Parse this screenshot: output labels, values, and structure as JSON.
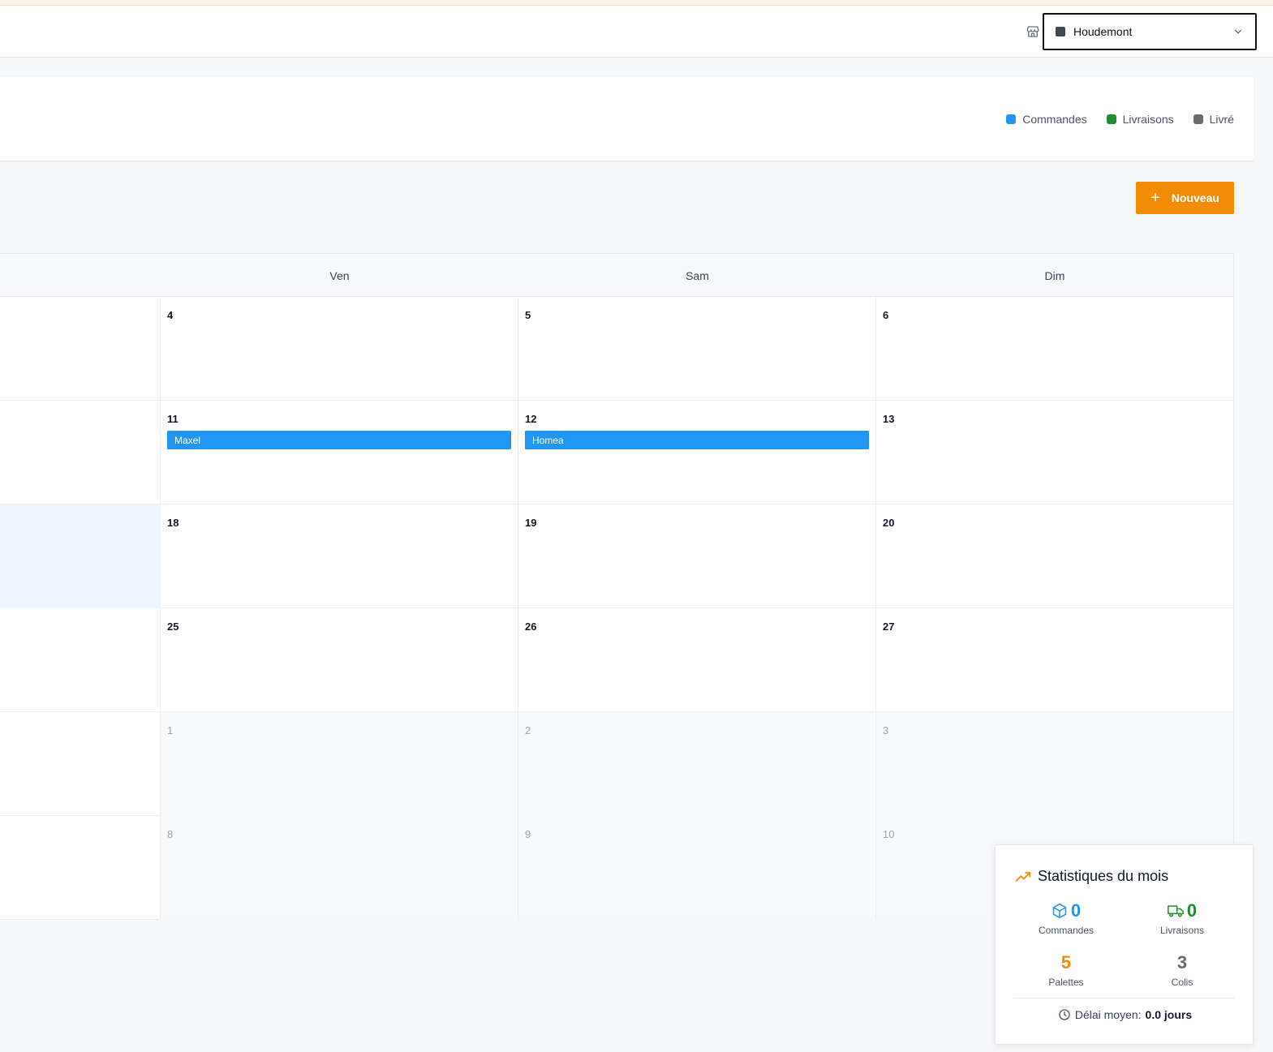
{
  "header": {
    "store_icon": "store-icon",
    "store_select": {
      "value": "Houdemont",
      "swatch_color": "#3f4a55"
    }
  },
  "legend": [
    {
      "label": "Commandes",
      "color": "#2196f3"
    },
    {
      "label": "Livraisons",
      "color": "#1f8f2d"
    },
    {
      "label": "Livré",
      "color": "#6b6b6b"
    }
  ],
  "toolbar": {
    "new_label": "Nouveau",
    "accent": "#f28c06"
  },
  "calendar": {
    "weekdays": [
      "Ven",
      "Sam",
      "Dim"
    ],
    "weeks": [
      {
        "days": [
          "4",
          "5",
          "6"
        ]
      },
      {
        "days": [
          "11",
          "12",
          "13"
        ]
      },
      {
        "days": [
          "18",
          "19",
          "20"
        ]
      },
      {
        "days": [
          "25",
          "26",
          "27"
        ]
      },
      {
        "days": [
          "1",
          "2",
          "3"
        ]
      },
      {
        "days": [
          "8",
          "9",
          "10"
        ]
      }
    ],
    "events": [
      {
        "day": "11",
        "title": "Maxel"
      },
      {
        "day": "12",
        "title": "Homea"
      }
    ]
  },
  "stats": {
    "title": "Statistiques du mois",
    "commandes": {
      "value": "0",
      "label": "Commandes"
    },
    "livraisons": {
      "value": "0",
      "label": "Livraisons"
    },
    "palettes": {
      "value": "5",
      "label": "Palettes"
    },
    "colis": {
      "value": "3",
      "label": "Colis"
    },
    "delai_label": "Délai moyen:",
    "delai_value": "0.0 jours"
  }
}
